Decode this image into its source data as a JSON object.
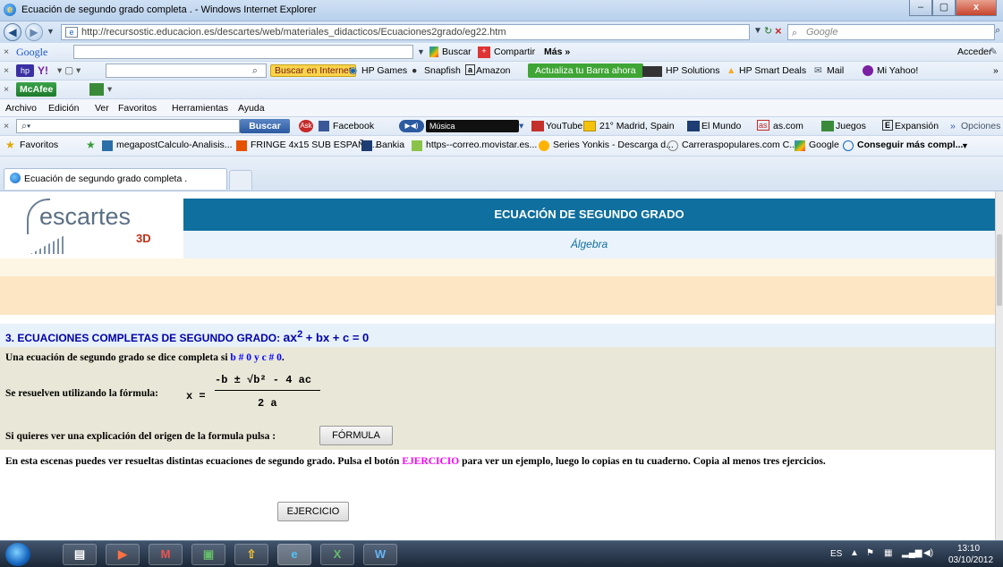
{
  "window": {
    "title": "Ecuación de segundo grado completa . - Windows Internet Explorer",
    "controls": [
      "–",
      "▢",
      "x"
    ]
  },
  "address": {
    "url": "http://recursostic.educacion.es/descartes/web/materiales_didacticos/Ecuaciones2grado/eg22.htm",
    "search_placeholder": "Google"
  },
  "google_bar": {
    "brand": "Google",
    "buscar": "Buscar",
    "compartir": "Compartir",
    "mas": "Más »",
    "acceder": "Acceder"
  },
  "yahoo_bar": {
    "buscar_internet": "Buscar en Internet",
    "items": [
      "HP Games",
      "Snapfish",
      "Amazon"
    ],
    "actualiza": "Actualiza tu Barra ahora",
    "hp_solutions": "HP Solutions",
    "hp_deals": "HP Smart Deals",
    "mail": "Mail",
    "mi_yahoo": "Mi Yahoo!"
  },
  "mcafee_bar": {
    "label": "McAfee"
  },
  "menu": {
    "items": [
      "Archivo",
      "Edición",
      "Ver",
      "Favoritos",
      "Herramientas",
      "Ayuda"
    ]
  },
  "ask_bar": {
    "buscar": "Buscar",
    "facebook": "Facebook",
    "musica": "Música",
    "youtube": "YouTube",
    "weather": "21° Madrid, Spain",
    "elmundo": "El Mundo",
    "as": "as.com",
    "juegos": "Juegos",
    "expansion": "Expansión",
    "opciones": "Opciones"
  },
  "favorites": {
    "label": "Favoritos",
    "items": [
      "megapostCalculo-Analisis...",
      "FRINGE 4x15 SUB ESPAÑO...",
      "Bankia",
      "https--correo.movistar.es...",
      "Series Yonkis - Descarga d...",
      "Carreraspopulares.com C...",
      "Google",
      "Conseguir más compl..."
    ]
  },
  "tab": {
    "label": "Ecuación de segundo grado completa ."
  },
  "page": {
    "logo_text": "escartes",
    "logo_sub": "3D",
    "header_title": "ECUACIÓN DE SEGUNDO GRADO",
    "header_subtitle": "Álgebra",
    "section_title": "3. ECUACIONES COMPLETAS DE SEGUNDO GRADO: ",
    "section_formula_a": "ax",
    "section_formula_exp": "2",
    "section_formula_rest": " + bx + c = 0",
    "line1_prefix": "Una ecuación de segundo grado se dice completa si ",
    "line1_cond1": "b # 0",
    "line1_and": " y ",
    "line1_cond2": "c # 0",
    "line1_end": ".",
    "line2": "Se resuelven utilizando la fórmula:",
    "formula_x": "x =",
    "formula_num": "-b ± √b² - 4 ac",
    "formula_den": "2 a",
    "line3": "Si quieres ver una explicación del origen de la formula pulsa :",
    "formula_button": "FÓRMULA",
    "line4_prefix": "En esta escenas puedes ver  resueltas distintas ecuaciones de segundo grado. Pulsa el botón ",
    "line4_highlight": "EJERCICIO",
    "line4_suffix": " para ver un ejemplo, luego lo copias en tu cuaderno. Copia al menos tres ejercicios.",
    "ejercicio_button": "EJERCICIO",
    "magenta": "#ff00ff",
    "header_blue": "#0f6f9e"
  },
  "taskbar": {
    "lang": "ES",
    "time": "13:10",
    "date": "03/10/2012"
  }
}
